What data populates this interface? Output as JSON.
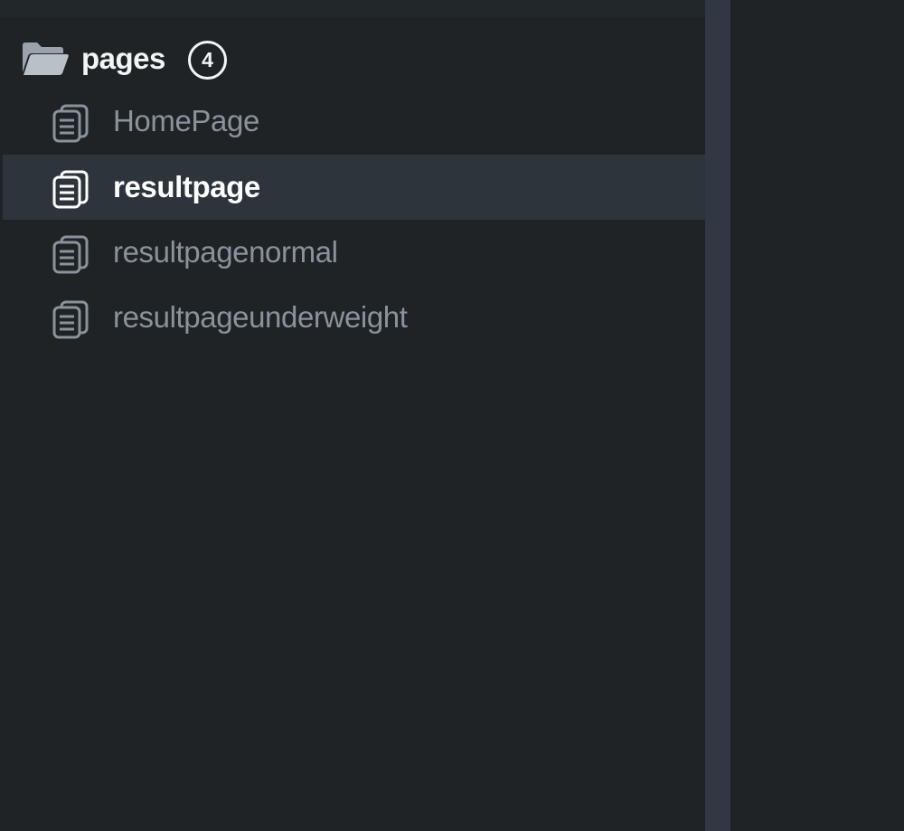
{
  "explorer": {
    "folder": {
      "label": "pages",
      "count": "4",
      "icon": "folder-open-icon"
    },
    "files": [
      {
        "label": "HomePage",
        "icon": "pages-file-icon",
        "selected": false
      },
      {
        "label": "resultpage",
        "icon": "pages-file-icon",
        "selected": true
      },
      {
        "label": "resultpagenormal",
        "icon": "pages-file-icon",
        "selected": false
      },
      {
        "label": "resultpageunderweight",
        "icon": "pages-file-icon",
        "selected": false
      }
    ]
  },
  "colors": {
    "background": "#1f2326",
    "selected_row": "#2d343b",
    "splitter": "#323843",
    "text_active": "#ffffff",
    "text_muted": "#8a929c"
  }
}
